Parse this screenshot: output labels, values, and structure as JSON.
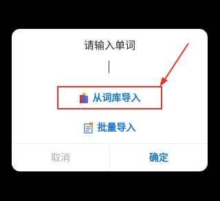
{
  "dialog": {
    "title": "请输入单词",
    "input_value": ""
  },
  "options": {
    "library": {
      "label": "从词库导入",
      "icon": "book-stack-icon"
    },
    "batch": {
      "label": "批量导入",
      "icon": "document-list-icon"
    }
  },
  "footer": {
    "cancel_label": "取消",
    "confirm_label": "确定"
  },
  "colors": {
    "accent": "#1677c9",
    "highlight": "#e8322a",
    "muted": "#aaaaaa",
    "background": "#000000"
  }
}
